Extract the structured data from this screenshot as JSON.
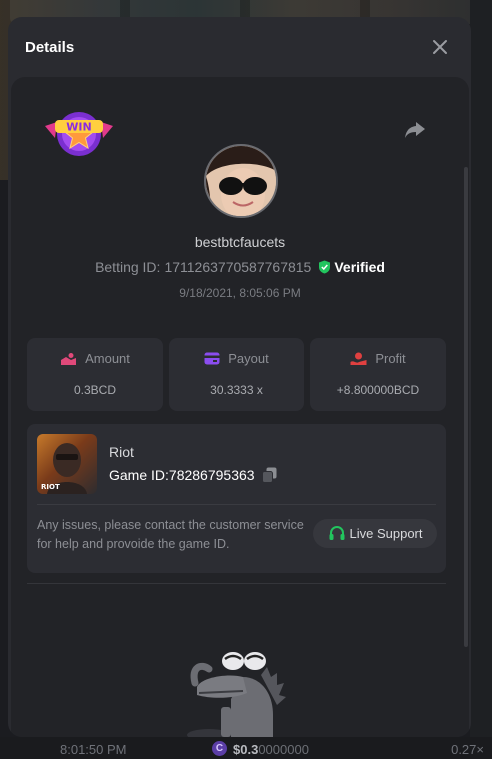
{
  "background": {
    "time": "8:01:50 PM",
    "coin_symbol": "C",
    "amount_main": "$0.3",
    "amount_dim": "0000000",
    "multiplier": "0.27×"
  },
  "dialog": {
    "title": "Details",
    "close_icon": "close-icon"
  },
  "bet": {
    "badge_text": "WIN",
    "username": "bestbtcfaucets",
    "betting_id_label": "Betting ID:",
    "betting_id": "1711263770587767815",
    "verified_label": "Verified",
    "datetime": "9/18/2021, 8:05:06 PM"
  },
  "stats": [
    {
      "label": "Amount",
      "value": "0.3BCD",
      "icon": "amount-icon"
    },
    {
      "label": "Payout",
      "value": "30.3333 x",
      "icon": "payout-icon"
    },
    {
      "label": "Profit",
      "value": "+8.800000BCD",
      "icon": "profit-icon"
    }
  ],
  "game": {
    "name": "Riot",
    "game_id_label": "Game ID:",
    "game_id": "78286795363",
    "thumb_label": "RIOT",
    "support_text": "Any issues, please contact the customer service for help and provoide the game ID.",
    "support_button": "Live Support"
  },
  "colors": {
    "accent_green": "#22c55e",
    "amount_icon": "#e0497a",
    "payout_icon": "#8b4df0",
    "profit_icon": "#e04040"
  }
}
